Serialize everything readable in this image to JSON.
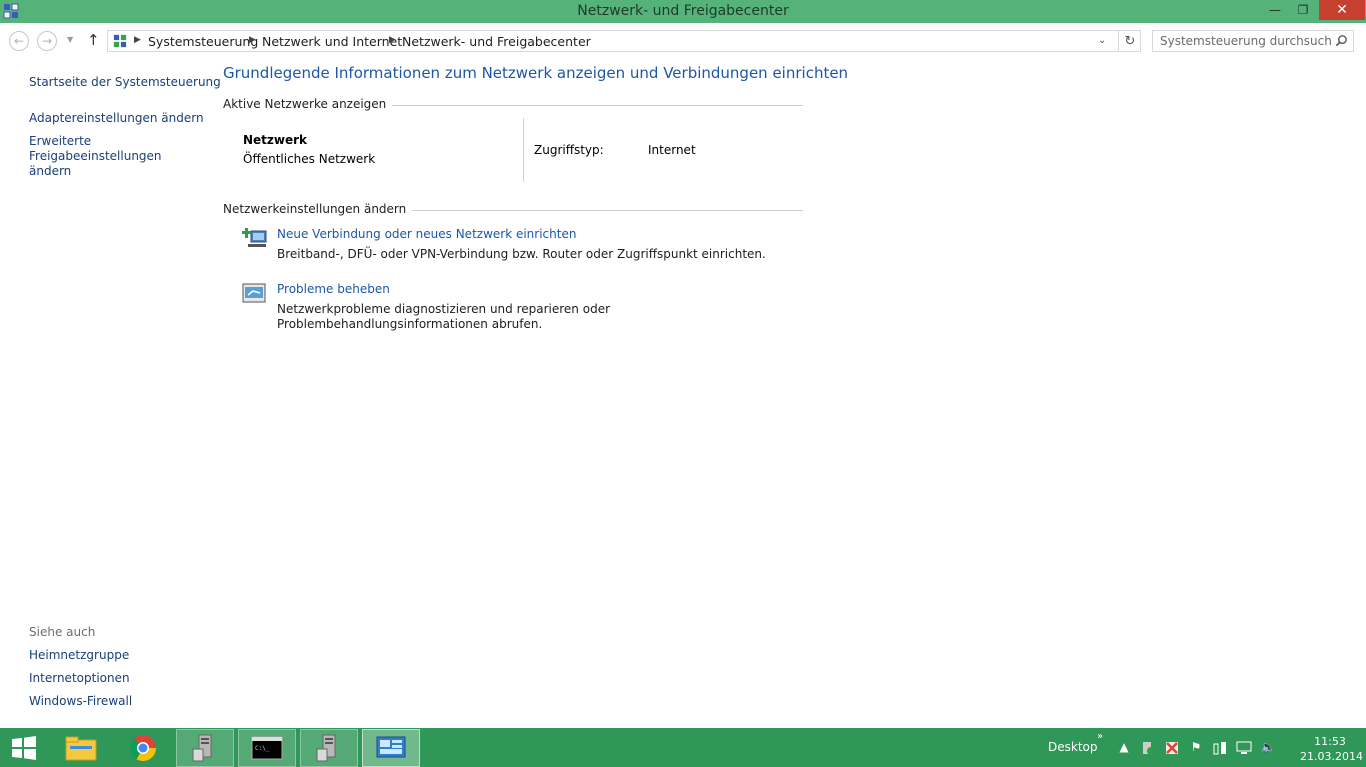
{
  "window": {
    "title": "Netzwerk- und Freigabecenter"
  },
  "address": {
    "crumbs": [
      "Systemsteuerung",
      "Netzwerk und Internet",
      "Netzwerk- und Freigabecenter"
    ],
    "search_placeholder": "Systemsteuerung durchsuchen"
  },
  "left_pane": {
    "links": [
      "Startseite der Systemsteuerung",
      "Adaptereinstellungen ändern",
      "Erweiterte Freigabeeinstellungen ändern"
    ],
    "see_also_heading": "Siehe auch",
    "see_also": [
      "Heimnetzgruppe",
      "Internetoptionen",
      "Windows-Firewall"
    ]
  },
  "main": {
    "title": "Grundlegende Informationen zum Netzwerk anzeigen und Verbindungen einrichten",
    "active_networks_heading": "Aktive Netzwerke anzeigen",
    "network": {
      "name": "Netzwerk",
      "type": "Öffentliches Netzwerk",
      "access_label": "Zugriffstyp:",
      "access_value": "Internet"
    },
    "settings_heading": "Netzwerkeinstellungen ändern",
    "tasks": [
      {
        "link": "Neue Verbindung oder neues Netzwerk einrichten",
        "description": "Breitband-, DFÜ- oder VPN-Verbindung bzw. Router oder Zugriffspunkt einrichten.",
        "icon": "new-connection-icon"
      },
      {
        "link": "Probleme beheben",
        "description": "Netzwerkprobleme diagnostizieren und reparieren oder Problembehandlungsinformationen abrufen.",
        "icon": "troubleshoot-icon"
      }
    ]
  },
  "taskbar": {
    "desktop_label": "Desktop",
    "chevron": "»",
    "time": "11:53",
    "date": "21.03.2014",
    "colors": {
      "bar": "#2f9757",
      "titlebar": "#55b37a",
      "link": "#1d57a8"
    }
  }
}
